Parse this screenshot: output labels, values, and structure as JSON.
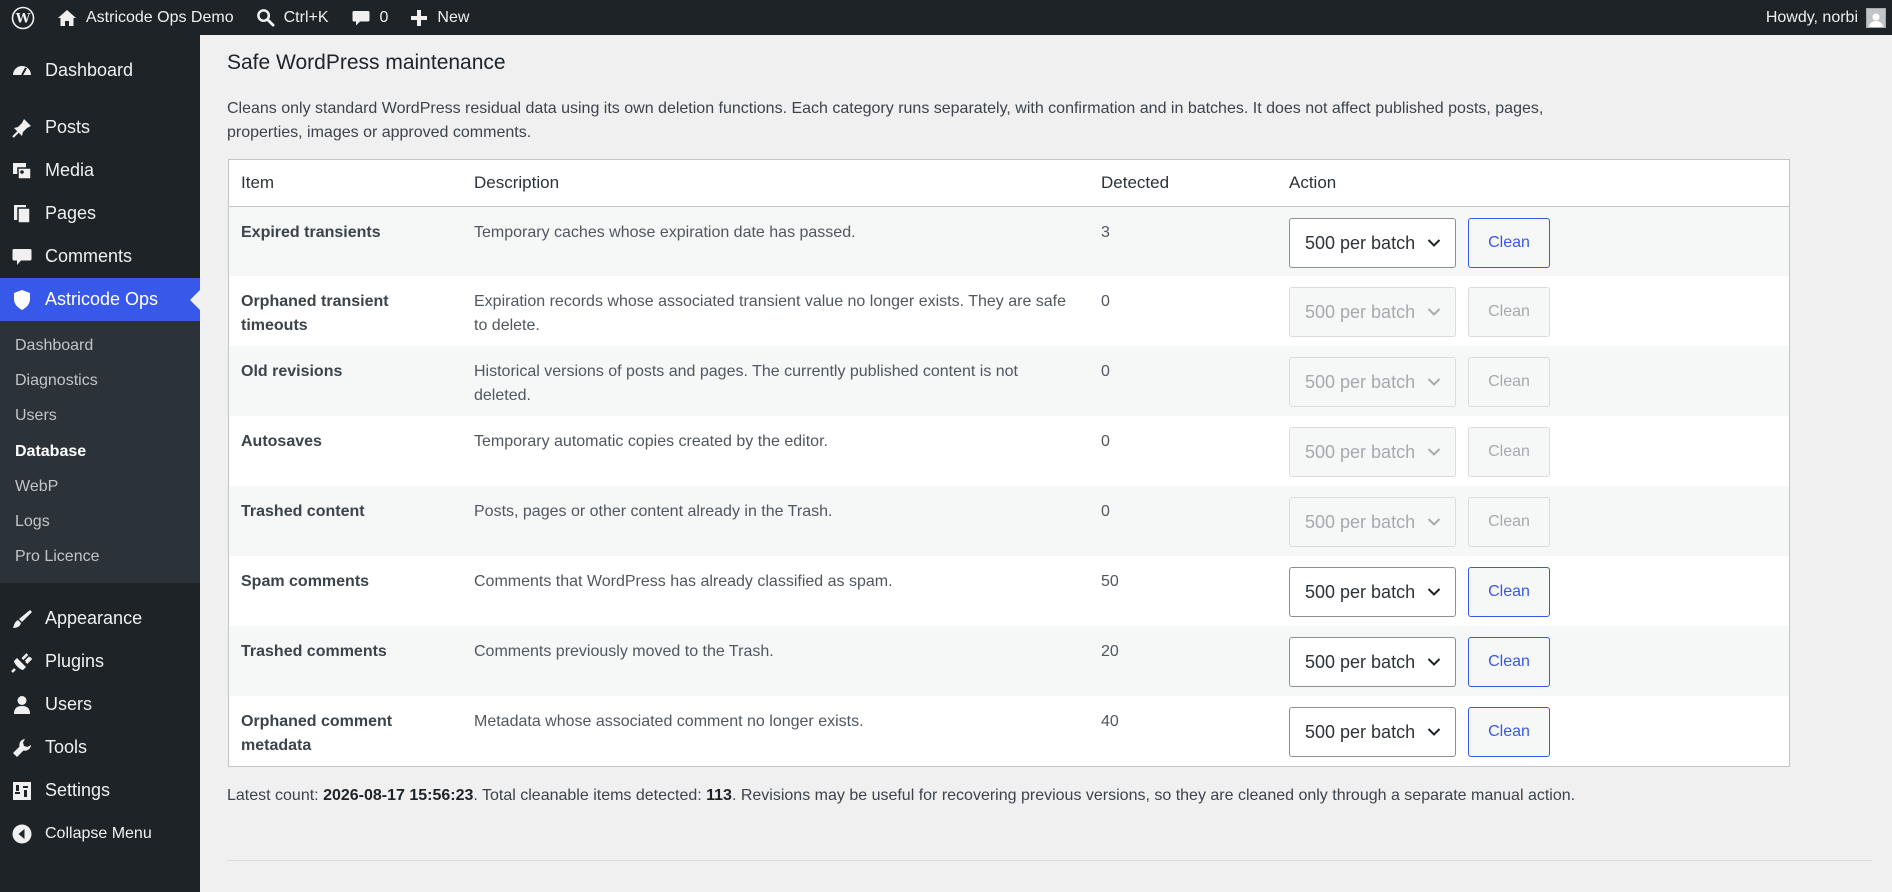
{
  "adminbar": {
    "site_name": "Astricode Ops Demo",
    "search_shortcut": "Ctrl+K",
    "comments_count": "0",
    "new_label": "New",
    "greeting": "Howdy, norbi"
  },
  "sidebar": {
    "items_top": [
      {
        "label": "Dashboard",
        "icon": "dashboard-icon"
      },
      {
        "label": "Posts",
        "icon": "pin-icon"
      },
      {
        "label": "Media",
        "icon": "media-icon"
      },
      {
        "label": "Pages",
        "icon": "pages-icon"
      },
      {
        "label": "Comments",
        "icon": "comment-icon"
      },
      {
        "label": "Astricode Ops",
        "icon": "shield-icon"
      }
    ],
    "submenu": [
      "Dashboard",
      "Diagnostics",
      "Users",
      "Database",
      "WebP",
      "Logs",
      "Pro Licence"
    ],
    "items_bottom": [
      {
        "label": "Appearance",
        "icon": "brush-icon"
      },
      {
        "label": "Plugins",
        "icon": "plug-icon"
      },
      {
        "label": "Users",
        "icon": "user-icon"
      },
      {
        "label": "Tools",
        "icon": "wrench-icon"
      },
      {
        "label": "Settings",
        "icon": "settings-icon"
      },
      {
        "label": "Collapse Menu",
        "icon": "collapse-icon"
      }
    ]
  },
  "main": {
    "title": "Safe WordPress maintenance",
    "intro": "Cleans only standard WordPress residual data using its own deletion functions. Each category runs separately, with confirmation and in batches. It does not affect published posts, pages, properties, images or approved comments.",
    "table": {
      "headers": [
        "Item",
        "Description",
        "Detected",
        "Action"
      ],
      "rows": [
        {
          "item": "Expired transients",
          "description": "Temporary caches whose expiration date has passed.",
          "detected": "3",
          "batch": "500 per batch",
          "button": "Clean",
          "enabled": true
        },
        {
          "item": "Orphaned transient timeouts",
          "description": "Expiration records whose associated transient value no longer exists. They are safe to delete.",
          "detected": "0",
          "batch": "500 per batch",
          "button": "Clean",
          "enabled": false
        },
        {
          "item": "Old revisions",
          "description": "Historical versions of posts and pages. The currently published content is not deleted.",
          "detected": "0",
          "batch": "500 per batch",
          "button": "Clean",
          "enabled": false
        },
        {
          "item": "Autosaves",
          "description": "Temporary automatic copies created by the editor.",
          "detected": "0",
          "batch": "500 per batch",
          "button": "Clean",
          "enabled": false
        },
        {
          "item": "Trashed content",
          "description": "Posts, pages or other content already in the Trash.",
          "detected": "0",
          "batch": "500 per batch",
          "button": "Clean",
          "enabled": false
        },
        {
          "item": "Spam comments",
          "description": "Comments that WordPress has already classified as spam.",
          "detected": "50",
          "batch": "500 per batch",
          "button": "Clean",
          "enabled": true
        },
        {
          "item": "Trashed comments",
          "description": "Comments previously moved to the Trash.",
          "detected": "20",
          "batch": "500 per batch",
          "button": "Clean",
          "enabled": true
        },
        {
          "item": "Orphaned comment metadata",
          "description": "Metadata whose associated comment no longer exists.",
          "detected": "40",
          "batch": "500 per batch",
          "button": "Clean",
          "enabled": true
        }
      ]
    },
    "footer": {
      "prefix": "Latest count: ",
      "timestamp": "2026-08-17 15:56:23",
      "middle": ". Total cleanable items detected: ",
      "total": "113",
      "suffix": ". Revisions may be useful for recovering previous versions, so they are cleaned only through a separate manual action."
    }
  },
  "colors": {
    "accent": "#3858e9",
    "sidebar_bg": "#1d2327",
    "submenu_bg": "#2c3338"
  }
}
